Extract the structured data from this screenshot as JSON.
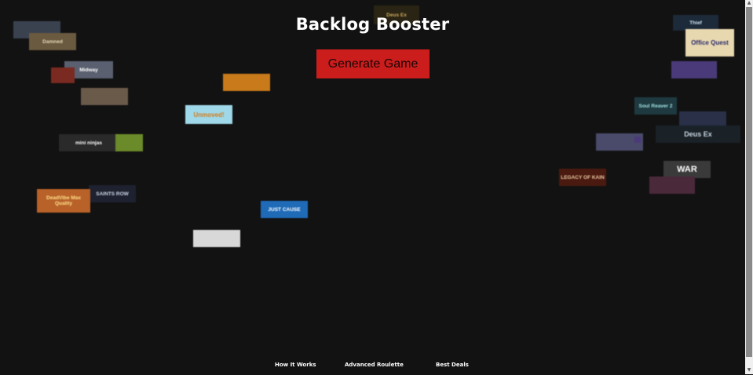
{
  "header": {
    "title": "Backlog Booster",
    "generate_label": "Generate Game"
  },
  "footer": {
    "links": [
      "How It Works",
      "Advanced Roulette",
      "Best Deals"
    ]
  },
  "scrollbar": {
    "up_icon": "chevron-up-icon",
    "down_icon": "chevron-down-icon"
  },
  "covers": [
    {
      "label": "Deus Ex",
      "bg": "#2a2414",
      "fg": "#c9a95a"
    },
    {
      "label": "",
      "bg": "#3a4250",
      "fg": "#ffffff"
    },
    {
      "label": "Damned",
      "bg": "#6a5a40",
      "fg": "#e7d7b8"
    },
    {
      "label": "Midway",
      "bg": "#5a6070",
      "fg": "#ffffff"
    },
    {
      "label": "",
      "bg": "#7a2a20",
      "fg": "#ffffff"
    },
    {
      "label": "",
      "bg": "#c97a1a",
      "fg": "#3a1a06"
    },
    {
      "label": "",
      "bg": "#6a5a4a",
      "fg": "#e8dcc4"
    },
    {
      "label": "Unmoved!",
      "bg": "#9fd8e8",
      "fg": "#d27a1a"
    },
    {
      "label": "mini ninjas",
      "bg": "#2a2a2a",
      "fg": "#ffffff"
    },
    {
      "label": "",
      "bg": "#6b8a2a",
      "fg": "#ffffff"
    },
    {
      "label": "SAINTS ROW",
      "bg": "#1e2230",
      "fg": "#cfd6e6"
    },
    {
      "label": "DeadVibe Max Quality",
      "bg": "#b8622a",
      "fg": "#ffe08a"
    },
    {
      "label": "JUST CAUSE",
      "bg": "#1f6bb8",
      "fg": "#ffffff"
    },
    {
      "label": "",
      "bg": "#d8d8d8",
      "fg": "#333333"
    },
    {
      "label": "Thief",
      "bg": "#1c2a3a",
      "fg": "#cfe3f0"
    },
    {
      "label": "Office Quest",
      "bg": "#e8d8b0",
      "fg": "#2a2a6a"
    },
    {
      "label": "",
      "bg": "#4a3a7a",
      "fg": "#ffffff"
    },
    {
      "label": "Soul Reaver 2",
      "bg": "#1e3a40",
      "fg": "#9fe0e0"
    },
    {
      "label": "",
      "bg": "#2a3048",
      "fg": "#ffffff"
    },
    {
      "label": "Deus Ex",
      "bg": "#1a2228",
      "fg": "#c9d6e0"
    },
    {
      "label": "",
      "bg": "#4a4a6a",
      "fg": "#ffffff"
    },
    {
      "label": "",
      "bg": "#4a3a7a",
      "fg": "#ffffff"
    },
    {
      "label": "WAR",
      "bg": "#3a3a3a",
      "fg": "#ffffff"
    },
    {
      "label": "LEGACY OF KAIN",
      "bg": "#4a1a10",
      "fg": "#e8c8a0"
    },
    {
      "label": "",
      "bg": "#4a2a3a",
      "fg": "#ffb84a"
    }
  ]
}
